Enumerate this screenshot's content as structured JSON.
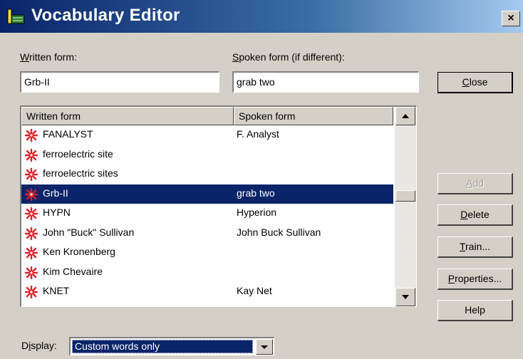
{
  "window": {
    "title": "Vocabulary Editor",
    "close_glyph": "×"
  },
  "written_form": {
    "label_accel": "W",
    "label_rest": "ritten form:",
    "value": "Grb-II"
  },
  "spoken_form": {
    "label_accel": "S",
    "label_rest": "poken form (if different):",
    "value": "grab two"
  },
  "list": {
    "columns": [
      "Written form",
      "Spoken form"
    ],
    "rows": [
      {
        "written": "FANALYST",
        "spoken": "F. Analyst",
        "selected": false
      },
      {
        "written": "ferroelectric site",
        "spoken": "",
        "selected": false
      },
      {
        "written": "ferroelectric sites",
        "spoken": "",
        "selected": false
      },
      {
        "written": "Grb-II",
        "spoken": "grab two",
        "selected": true
      },
      {
        "written": "HYPN",
        "spoken": "Hyperion",
        "selected": false
      },
      {
        "written": "John \"Buck\" Sullivan",
        "spoken": "John Buck Sullivan",
        "selected": false
      },
      {
        "written": "Ken Kronenberg",
        "spoken": "",
        "selected": false
      },
      {
        "written": "Kim Chevaire",
        "spoken": "",
        "selected": false
      },
      {
        "written": "KNET",
        "spoken": "Kay Net",
        "selected": false
      }
    ],
    "row_icon": "custom-word-icon"
  },
  "buttons": {
    "close": {
      "accel": "C",
      "rest": "lose"
    },
    "add": {
      "accel": "A",
      "rest": "dd"
    },
    "delete": {
      "accel": "D",
      "rest": "elete"
    },
    "train": {
      "accel": "T",
      "rest": "rain..."
    },
    "properties": {
      "accel": "P",
      "rest": "roperties..."
    },
    "help": {
      "label": "Help"
    }
  },
  "display": {
    "label_pre": "D",
    "label_accel": "i",
    "label_post": "splay:",
    "selected": "Custom words only"
  },
  "colors": {
    "selection": "#0a246a",
    "face": "#d4d0c8",
    "icon_red": "#e0202a"
  }
}
